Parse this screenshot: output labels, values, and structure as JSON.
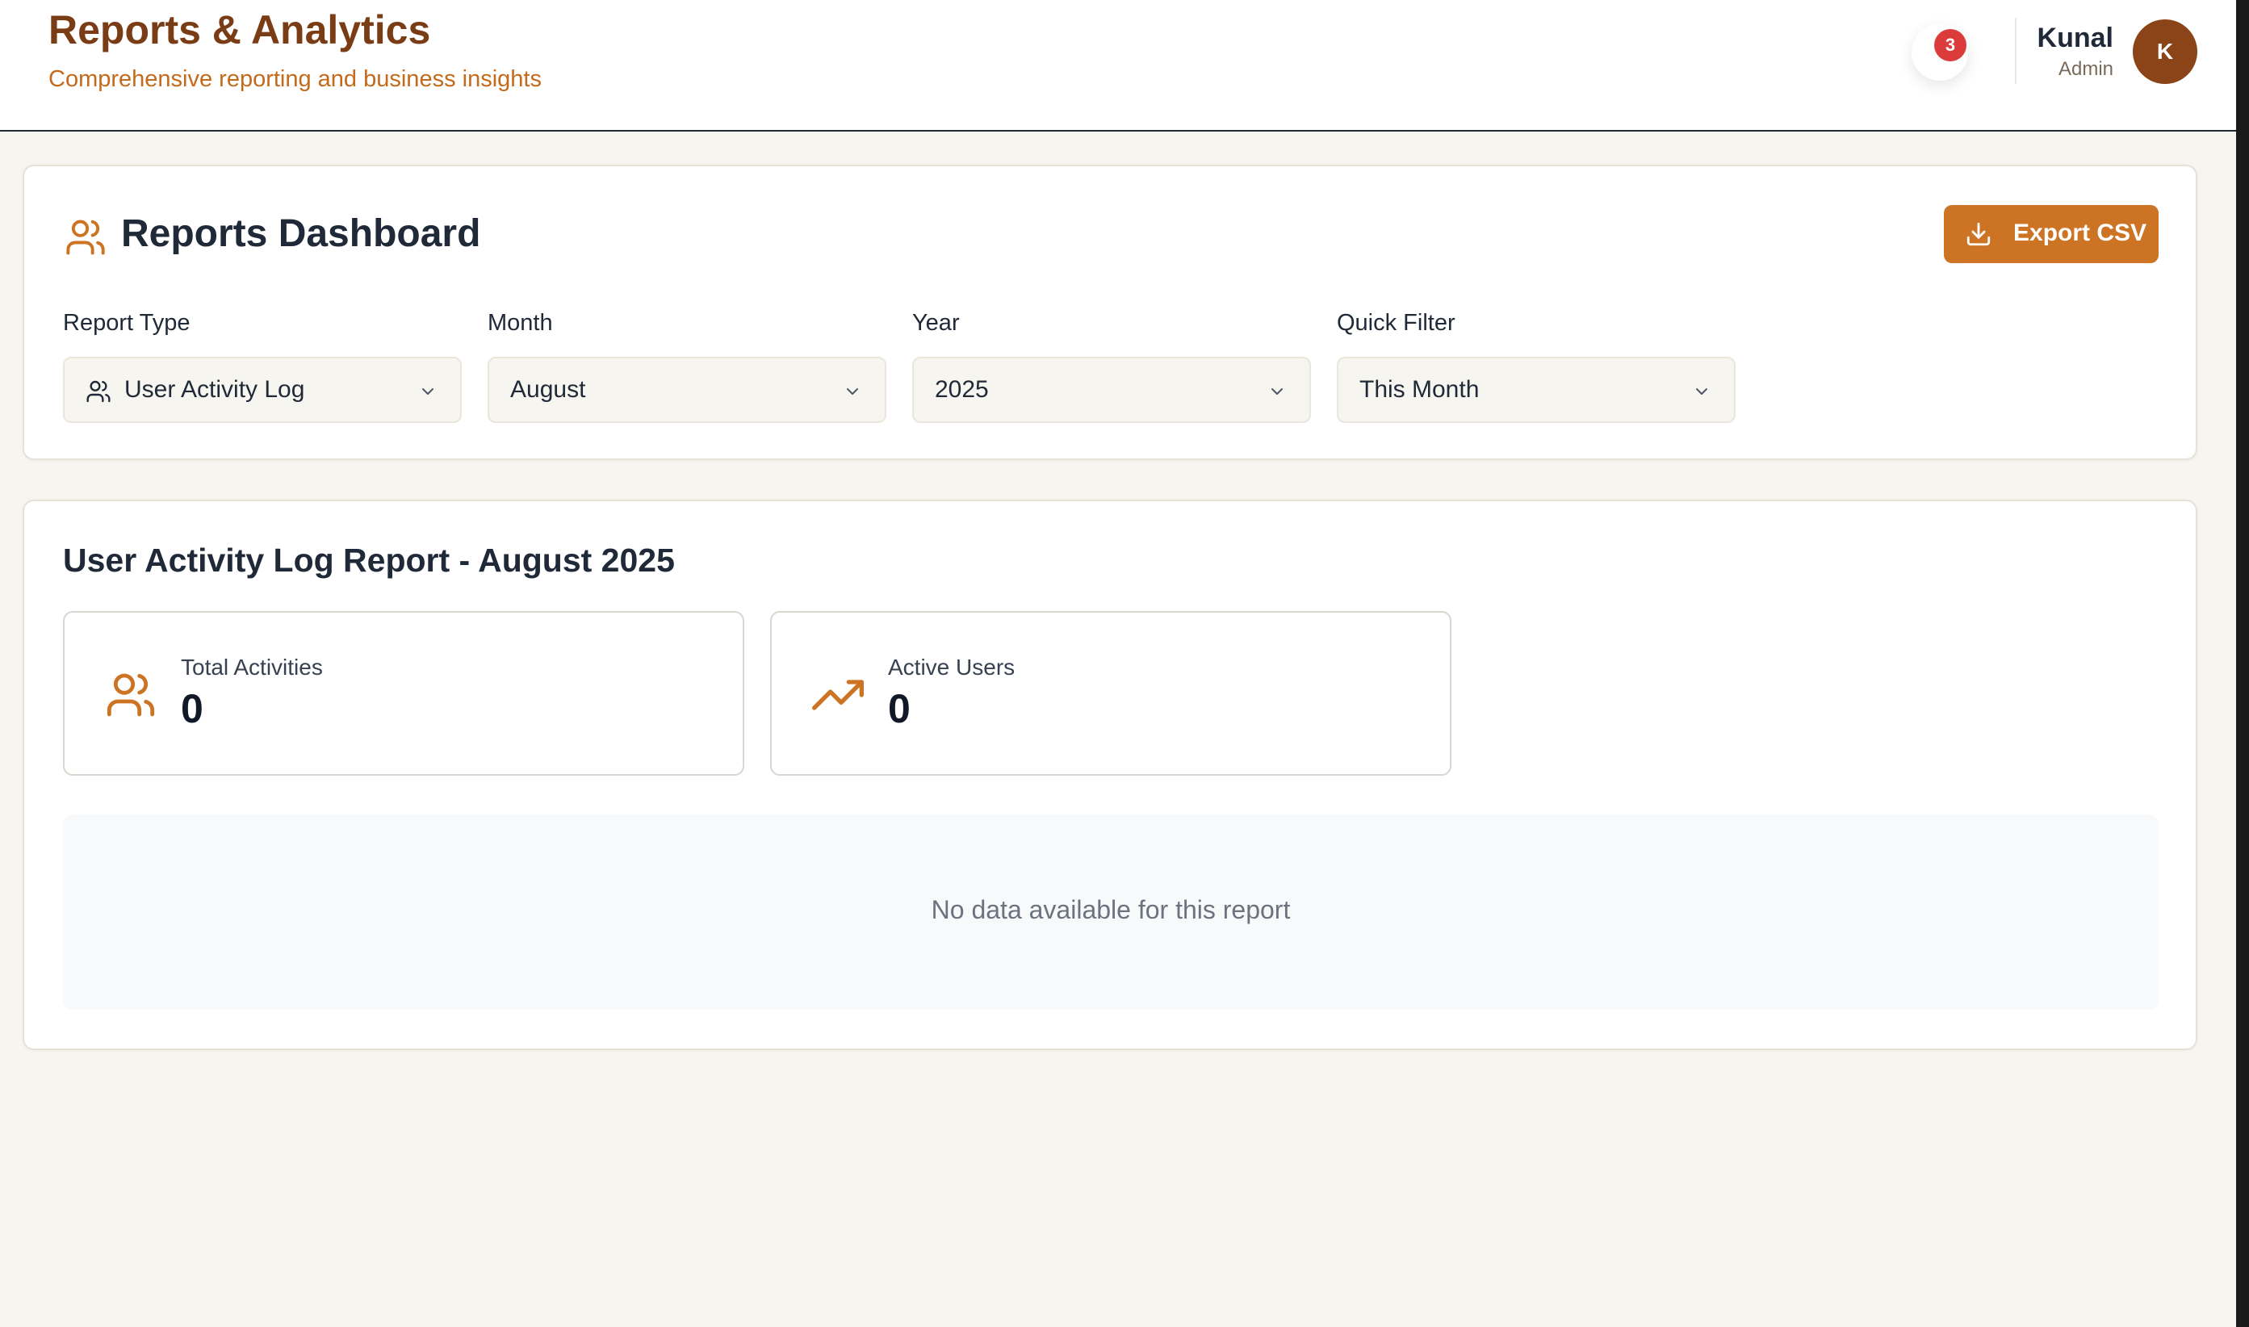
{
  "header": {
    "title": "Reports & Analytics",
    "subtitle": "Comprehensive reporting and business insights",
    "notification_count": "3",
    "user": {
      "name": "Kunal",
      "role": "Admin",
      "initial": "K"
    }
  },
  "dashboard": {
    "title": "Reports Dashboard",
    "export_label": "Export CSV",
    "filters": [
      {
        "label": "Report Type",
        "value": "User Activity Log",
        "icon": "users-icon"
      },
      {
        "label": "Month",
        "value": "August"
      },
      {
        "label": "Year",
        "value": "2025"
      },
      {
        "label": "Quick Filter",
        "value": "This Month"
      }
    ]
  },
  "report": {
    "title": "User Activity Log Report - August 2025",
    "stats": [
      {
        "label": "Total Activities",
        "value": "0",
        "icon": "users-icon"
      },
      {
        "label": "Active Users",
        "value": "0",
        "icon": "trending-up-icon"
      }
    ],
    "empty_message": "No data available for this report"
  },
  "colors": {
    "brand_dark": "#7a3c14",
    "brand_accent": "#cc7424",
    "badge": "#dc3b3b",
    "avatar": "#8a4418"
  }
}
